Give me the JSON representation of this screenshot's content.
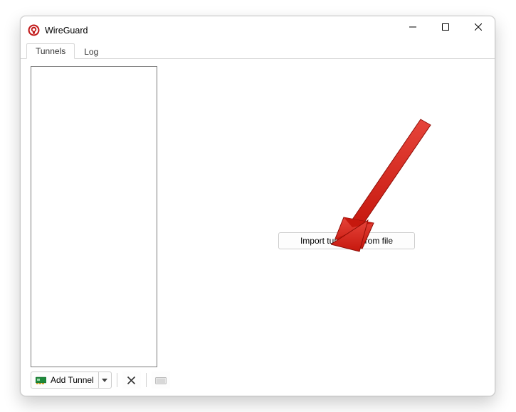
{
  "app": {
    "title": "WireGuard"
  },
  "tabs": [
    {
      "label": "Tunnels",
      "active": true
    },
    {
      "label": "Log",
      "active": false
    }
  ],
  "toolbar": {
    "add_tunnel_label": "Add Tunnel"
  },
  "main": {
    "import_button_label": "Import tunnel(s) from file"
  },
  "annotation": {
    "arrow_color": "#d92a1c"
  }
}
